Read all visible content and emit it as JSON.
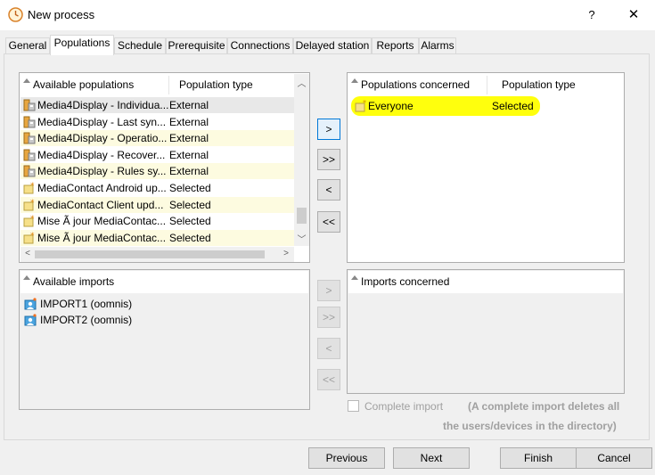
{
  "window": {
    "title": "New process",
    "help_label": "?",
    "close_label": "✕"
  },
  "tabs": [
    {
      "label": "General"
    },
    {
      "label": "Populations"
    },
    {
      "label": "Schedule"
    },
    {
      "label": "Prerequisite"
    },
    {
      "label": "Connections"
    },
    {
      "label": "Delayed station"
    },
    {
      "label": "Reports"
    },
    {
      "label": "Alarms"
    }
  ],
  "available_populations": {
    "col_name": "Available populations",
    "col_type": "Population type",
    "rows": [
      {
        "name": "Media4Display - Individua...",
        "type": "External",
        "icon": "external-population-icon"
      },
      {
        "name": "Media4Display - Last syn...",
        "type": "External",
        "icon": "external-population-icon"
      },
      {
        "name": "Media4Display - Operatio...",
        "type": "External",
        "icon": "external-population-icon"
      },
      {
        "name": "Media4Display - Recover...",
        "type": "External",
        "icon": "external-population-icon"
      },
      {
        "name": "Media4Display - Rules sy...",
        "type": "External",
        "icon": "external-population-icon"
      },
      {
        "name": "MediaContact Android up...",
        "type": "Selected",
        "icon": "selected-population-icon"
      },
      {
        "name": "MediaContact Client upd...",
        "type": "Selected",
        "icon": "selected-population-icon"
      },
      {
        "name": "Mise Ã  jour MediaContac...",
        "type": "Selected",
        "icon": "selected-population-icon"
      },
      {
        "name": "Mise Ã  jour MediaContac...",
        "type": "Selected",
        "icon": "selected-population-icon"
      }
    ]
  },
  "populations_concerned": {
    "col_name": "Populations concerned",
    "col_type": "Population type",
    "rows": [
      {
        "name": "Everyone",
        "type": "Selected",
        "icon": "selected-population-icon"
      }
    ]
  },
  "move_buttons": {
    "add": ">",
    "add_all": ">>",
    "remove": "<",
    "remove_all": "<<"
  },
  "available_imports": {
    "header": "Available imports",
    "rows": [
      {
        "name": "IMPORT1 (oomnis)",
        "icon": "import-icon"
      },
      {
        "name": "IMPORT2 (oomnis)",
        "icon": "import-icon"
      }
    ]
  },
  "imports_concerned": {
    "header": "Imports concerned"
  },
  "complete_import": {
    "label": "Complete import",
    "note_line1": "(A complete import deletes all",
    "note_line2": "the users/devices in the directory)"
  },
  "footer": {
    "previous": "Previous",
    "next": "Next",
    "finish": "Finish",
    "cancel": "Cancel"
  },
  "colors": {
    "highlight": "#ffff00",
    "focus": "#0078d7",
    "alt_row": "#fdfbe0"
  }
}
